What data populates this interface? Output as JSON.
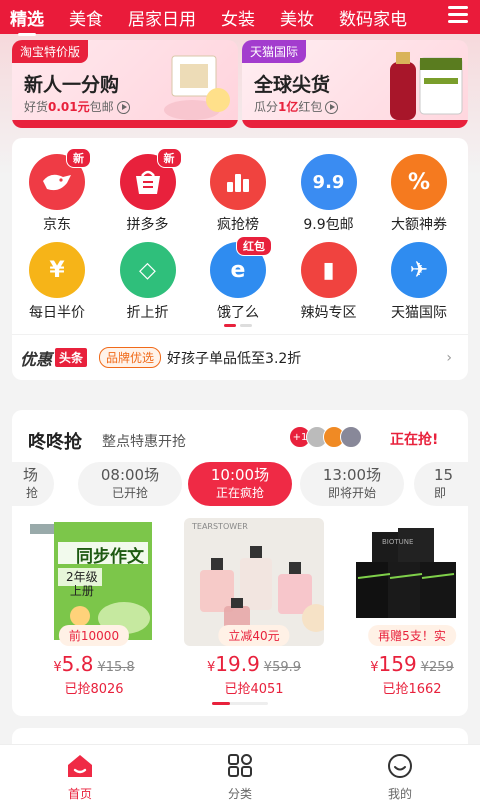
{
  "tabs": [
    "精选",
    "美食",
    "居家日用",
    "女装",
    "美妆",
    "数码家电"
  ],
  "banners": {
    "left": {
      "badge": "淘宝特价版",
      "title": "新人一分购",
      "sub_pre": "好货",
      "sub_price": "0.01元",
      "sub_post": "包邮"
    },
    "right": {
      "badge": "天猫国际",
      "title": "全球尖货",
      "sub_pre": "瓜分",
      "sub_price": "1亿",
      "sub_post": "红包"
    }
  },
  "grid": [
    {
      "label": "京东",
      "icon": "jd-dog-icon",
      "tag": "新",
      "color": "#ef3b45"
    },
    {
      "label": "拼多多",
      "icon": "pinduoduo-icon",
      "tag": "新",
      "color": "#e8213c"
    },
    {
      "label": "疯抢榜",
      "icon": "ranking-chart-icon",
      "tag": "",
      "color": "#f0433f"
    },
    {
      "label": "9.9包邮",
      "icon": "nine-nine-icon",
      "tag": "",
      "color": "#3a8cf2",
      "glyph": "9.9"
    },
    {
      "label": "大额神券",
      "icon": "coupon-icon",
      "tag": "",
      "color": "#f57a1f",
      "glyph": "%"
    },
    {
      "label": "每日半价",
      "icon": "yen-bag-icon",
      "tag": "",
      "color": "#f6b418",
      "glyph": "¥"
    },
    {
      "label": "折上折",
      "icon": "price-tag-icon",
      "tag": "",
      "color": "#2fbf7b",
      "glyph": "◇"
    },
    {
      "label": "饿了么",
      "icon": "eleme-icon",
      "tag": "红包",
      "color": "#2f8cf0",
      "glyph": "e"
    },
    {
      "label": "辣妈专区",
      "icon": "baby-bottle-icon",
      "tag": "",
      "color": "#f0433f",
      "glyph": "▮"
    },
    {
      "label": "天猫国际",
      "icon": "airplane-globe-icon",
      "tag": "",
      "color": "#2f8cf0",
      "glyph": "✈"
    }
  ],
  "news": {
    "logo_a": "优惠",
    "logo_b": "头条",
    "pill": "品牌优选",
    "text": "好孩子单品低至3.2折"
  },
  "sale": {
    "title": "咚咚抢",
    "subtitle": "整点特惠开抢",
    "avatar_count": "+1",
    "status": "正在抢!",
    "sessions": [
      {
        "time": "场",
        "state": "抢"
      },
      {
        "time": "08:00场",
        "state": "已开抢"
      },
      {
        "time": "10:00场",
        "state": "正在疯抢"
      },
      {
        "time": "13:00场",
        "state": "即将开始"
      },
      {
        "time": "15",
        "state": "即"
      }
    ],
    "products": [
      {
        "name": "同步作文",
        "grade": "2年级",
        "term": "上册",
        "badge": "前10000",
        "price": "5.8",
        "orig": "¥15.8",
        "sold": "已抢8026"
      },
      {
        "name": "TEARSTOWER",
        "badge": "立减40元",
        "price": "19.9",
        "orig": "¥59.9",
        "sold": "已抢4051"
      },
      {
        "name": "BIOTUNE",
        "badge": "再赠5支！实",
        "price": "159",
        "orig": "¥259",
        "sold": "已抢1662"
      }
    ],
    "currency": "¥"
  },
  "bottom_nav": [
    {
      "label": "首页",
      "icon": "home-icon"
    },
    {
      "label": "分类",
      "icon": "category-grid-icon"
    },
    {
      "label": "我的",
      "icon": "profile-smile-icon"
    }
  ]
}
